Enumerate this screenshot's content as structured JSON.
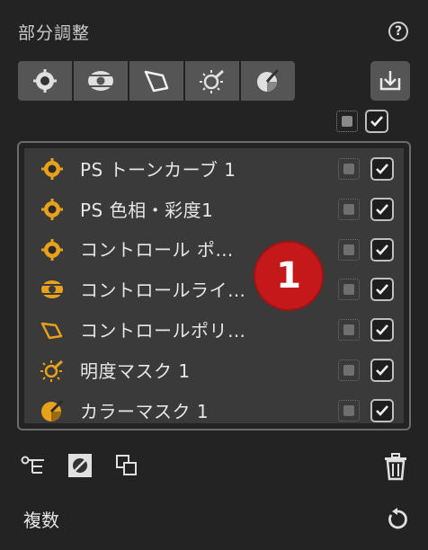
{
  "panel": {
    "title": "部分調整",
    "help_label": "?"
  },
  "toolbar": {
    "tools": [
      {
        "name": "control-point-tool"
      },
      {
        "name": "control-line-tool"
      },
      {
        "name": "control-polygon-tool"
      },
      {
        "name": "luminosity-mask-tool"
      },
      {
        "name": "color-mask-tool"
      }
    ],
    "import_icon": "download-icon"
  },
  "layers": {
    "items": [
      {
        "label": "PS トーンカーブ 1",
        "icon": "control-point-icon",
        "mask_on": false,
        "enabled": true
      },
      {
        "label": "PS 色相・彩度1",
        "icon": "control-point-icon",
        "mask_on": false,
        "enabled": true
      },
      {
        "label": "コントロール ポ…",
        "icon": "control-point-icon",
        "mask_on": false,
        "enabled": true
      },
      {
        "label": "コントロールライ…",
        "icon": "control-line-icon",
        "mask_on": false,
        "enabled": true
      },
      {
        "label": "コントロールポリ…",
        "icon": "control-polygon-icon",
        "mask_on": false,
        "enabled": true
      },
      {
        "label": "明度マスク 1",
        "icon": "luminosity-mask-icon",
        "mask_on": false,
        "enabled": true
      },
      {
        "label": "カラーマスク 1",
        "icon": "color-mask-icon",
        "mask_on": false,
        "enabled": true
      }
    ]
  },
  "badge": {
    "number": "1"
  },
  "footer": {
    "label": "複数"
  },
  "colors": {
    "accent": "#e8a11a",
    "badge": "#c3191b",
    "panel_bg": "#232323",
    "list_bg": "#3a3a3a"
  }
}
